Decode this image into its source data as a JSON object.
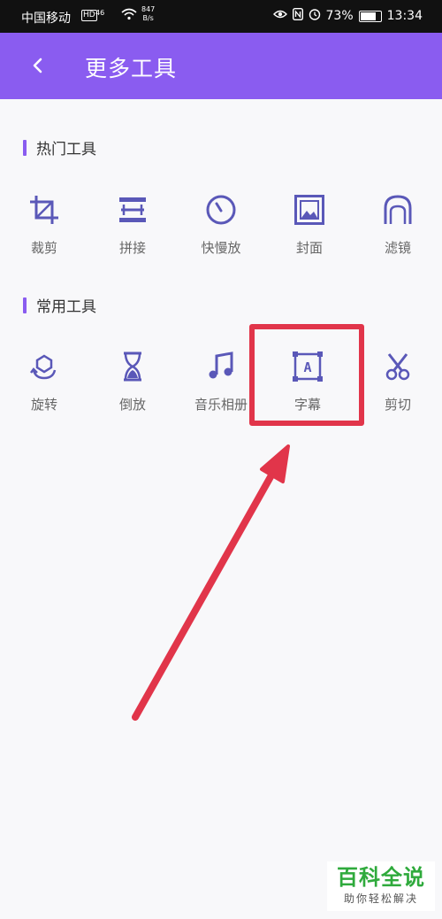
{
  "status_bar": {
    "carrier": "中国移动",
    "hd": "HD",
    "signal": "46",
    "speed_value": "847",
    "speed_unit": "B/s",
    "battery": "73%",
    "time": "13:34"
  },
  "app_bar": {
    "title": "更多工具"
  },
  "sections": {
    "hot": {
      "title": "热门工具",
      "tools": [
        {
          "label": "裁剪",
          "icon": "crop-icon"
        },
        {
          "label": "拼接",
          "icon": "splice-icon"
        },
        {
          "label": "快慢放",
          "icon": "speed-dial-icon"
        },
        {
          "label": "封面",
          "icon": "cover-image-icon"
        },
        {
          "label": "滤镜",
          "icon": "filter-face-icon"
        }
      ]
    },
    "common": {
      "title": "常用工具",
      "tools": [
        {
          "label": "旋转",
          "icon": "rotate-icon"
        },
        {
          "label": "倒放",
          "icon": "hourglass-icon"
        },
        {
          "label": "音乐相册",
          "icon": "music-note-icon"
        },
        {
          "label": "字幕",
          "icon": "subtitle-frame-icon",
          "icon_letter": "A"
        },
        {
          "label": "剪切",
          "icon": "scissors-icon"
        }
      ]
    }
  },
  "annotation": {
    "highlight_color": "#e1354a"
  },
  "watermark": {
    "main": "百科全说",
    "sub": "助你轻松解决"
  },
  "colors": {
    "accent": "#8a5cf0",
    "icon": "#5a58b8",
    "label": "#666666"
  }
}
